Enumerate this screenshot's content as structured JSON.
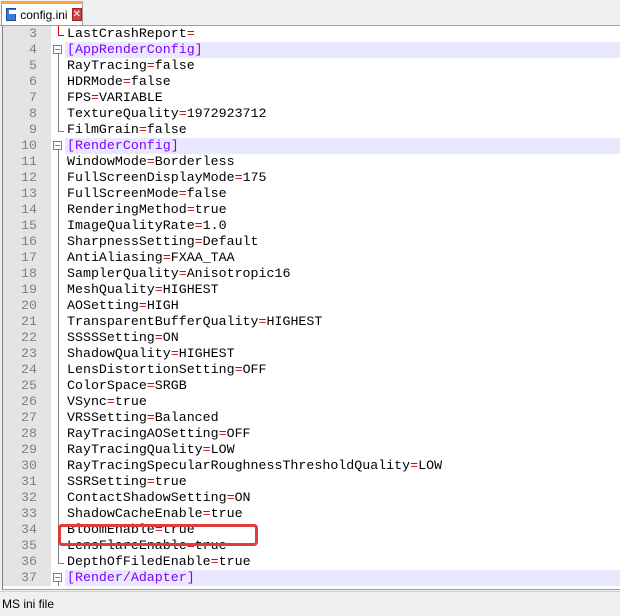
{
  "tab": {
    "title": "config.ini",
    "close": "✕"
  },
  "lines": [
    {
      "n": "3",
      "key": "LastCrashReport",
      "value": "",
      "fold": "end-red"
    },
    {
      "n": "4",
      "section": "[AppRenderConfig]",
      "fold": "box"
    },
    {
      "n": "5",
      "key": "RayTracing",
      "value": "false"
    },
    {
      "n": "6",
      "key": "HDRMode",
      "value": "false"
    },
    {
      "n": "7",
      "key": "FPS",
      "value": "VARIABLE"
    },
    {
      "n": "8",
      "key": "TextureQuality",
      "value": "1972923712"
    },
    {
      "n": "9",
      "key": "FilmGrain",
      "value": "false",
      "fold": "end"
    },
    {
      "n": "10",
      "section": "[RenderConfig]",
      "fold": "box"
    },
    {
      "n": "11",
      "key": "WindowMode",
      "value": "Borderless"
    },
    {
      "n": "12",
      "key": "FullScreenDisplayMode",
      "value": "175"
    },
    {
      "n": "13",
      "key": "FullScreenMode",
      "value": "false"
    },
    {
      "n": "14",
      "key": "RenderingMethod",
      "value": "true"
    },
    {
      "n": "15",
      "key": "ImageQualityRate",
      "value": "1.0"
    },
    {
      "n": "16",
      "key": "SharpnessSetting",
      "value": "Default"
    },
    {
      "n": "17",
      "key": "AntiAliasing",
      "value": "FXAA_TAA"
    },
    {
      "n": "18",
      "key": "SamplerQuality",
      "value": "Anisotropic16"
    },
    {
      "n": "19",
      "key": "MeshQuality",
      "value": "HIGHEST"
    },
    {
      "n": "20",
      "key": "AOSetting",
      "value": "HIGH"
    },
    {
      "n": "21",
      "key": "TransparentBufferQuality",
      "value": "HIGHEST"
    },
    {
      "n": "22",
      "key": "SSSSSetting",
      "value": "ON"
    },
    {
      "n": "23",
      "key": "ShadowQuality",
      "value": "HIGHEST"
    },
    {
      "n": "24",
      "key": "LensDistortionSetting",
      "value": "OFF"
    },
    {
      "n": "25",
      "key": "ColorSpace",
      "value": "SRGB"
    },
    {
      "n": "26",
      "key": "VSync",
      "value": "true"
    },
    {
      "n": "27",
      "key": "VRSSetting",
      "value": "Balanced"
    },
    {
      "n": "28",
      "key": "RayTracingAOSetting",
      "value": "OFF"
    },
    {
      "n": "29",
      "key": "RayTracingQuality",
      "value": "LOW"
    },
    {
      "n": "30",
      "key": "RayTracingSpecularRoughnessThresholdQuality",
      "value": "LOW"
    },
    {
      "n": "31",
      "key": "SSRSetting",
      "value": "true"
    },
    {
      "n": "32",
      "key": "ContactShadowSetting",
      "value": "ON"
    },
    {
      "n": "33",
      "key": "ShadowCacheEnable",
      "value": "true"
    },
    {
      "n": "34",
      "key": "BloomEnable",
      "value": "true"
    },
    {
      "n": "35",
      "key": "LensFlareEnable",
      "value": "true"
    },
    {
      "n": "36",
      "key": "DepthOfFiledEnable",
      "value": "true",
      "fold": "end"
    },
    {
      "n": "37",
      "section": "[Render/Adapter]",
      "fold": "box"
    }
  ],
  "status": {
    "language": "MS ini file"
  },
  "colors": {
    "section": "#8000ff",
    "equals": "#e00000",
    "highlight": "#e03c3c"
  }
}
